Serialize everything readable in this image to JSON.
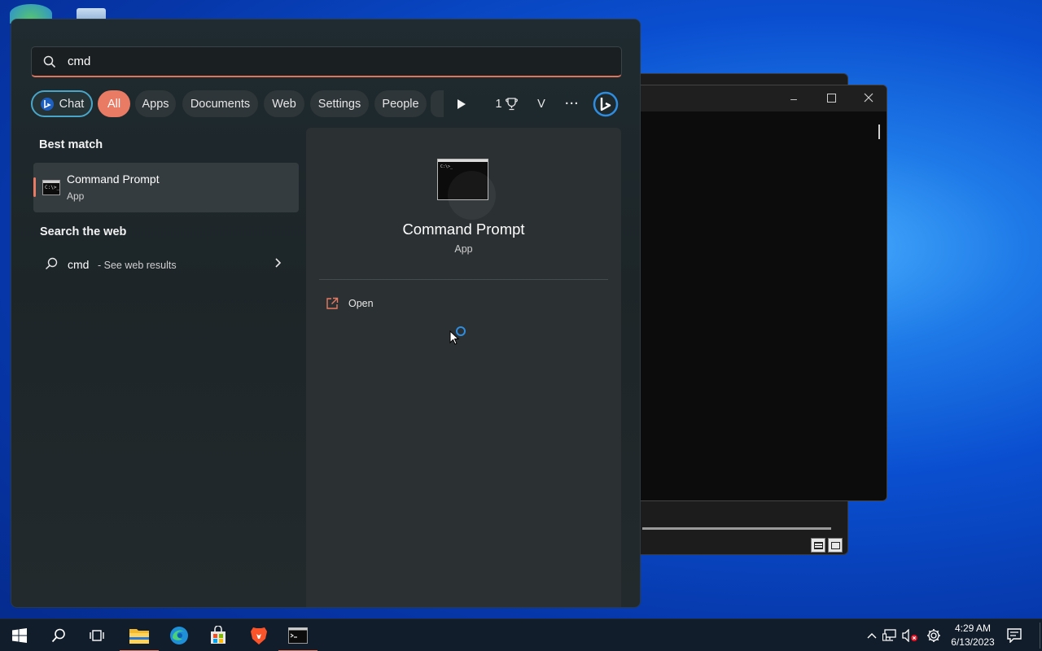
{
  "search": {
    "query": "cmd"
  },
  "filters": {
    "chat": "Chat",
    "all": "All",
    "apps": "Apps",
    "documents": "Documents",
    "web": "Web",
    "settings": "Settings",
    "people": "People",
    "points": "1",
    "avatar_initial": "V",
    "more": "···"
  },
  "best_match": {
    "heading": "Best match",
    "name": "Command Prompt",
    "type": "App"
  },
  "web_search": {
    "heading": "Search the web",
    "query": "cmd",
    "suffix": "- See web results"
  },
  "detail": {
    "name": "Command Prompt",
    "type": "App",
    "open_label": "Open"
  },
  "taskbar": {
    "time": "4:29 AM",
    "date": "6/13/2023"
  },
  "colors": {
    "accent": "#e97a63",
    "chat_border": "#4aa6c8",
    "spinner": "#2f8de0"
  }
}
